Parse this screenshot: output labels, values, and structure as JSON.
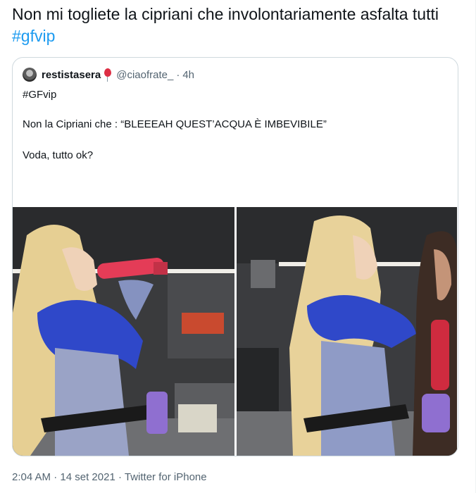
{
  "tweet": {
    "text": "Non mi togliete la cipriani che involontariamente asfalta tutti ",
    "hashtag": "#gfvip"
  },
  "quoted": {
    "name": "restistasera",
    "handle": "@ciaofrate_",
    "separator": "·",
    "time": "4h",
    "lines": [
      "#GFvip",
      "Non la Cipriani che : “BLEEEAH QUEST’ACQUA È IMBEVIBILE”",
      "Voda, tutto ok?"
    ],
    "emoji_icon": "sausage-icon",
    "badge_icon": "balloon-icon"
  },
  "footer": {
    "time": "2:04 AM",
    "sep1": "·",
    "date": "14 set 2021",
    "sep2": "·",
    "source": "Twitter for iPhone"
  },
  "colors": {
    "accent": "#1d9bf0",
    "text": "#0f1419",
    "secondary": "#536471",
    "border": "#cfd9de"
  }
}
